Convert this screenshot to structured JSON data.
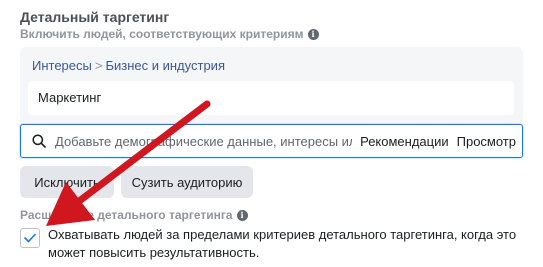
{
  "section": {
    "title": "Детальный таргетинг",
    "subtitle": "Включить людей, соответствующих критериям"
  },
  "selected": {
    "breadcrumb_parent": "Интересы",
    "breadcrumb_separator": ">",
    "breadcrumb_child": "Бизнес и индустрия",
    "item": "Маркетинг"
  },
  "search": {
    "placeholder": "Добавьте демографические данные, интересы или",
    "recommendations_label": "Рекомендации",
    "browse_label": "Просмотр"
  },
  "buttons": {
    "exclude": "Исключить",
    "narrow": "Сузить аудиторию"
  },
  "expansion": {
    "title": "Расширение детального таргетинга",
    "checkbox_checked": true,
    "text": "Охватывать людей за пределами критериев детального таргетинга, когда это может повысить результативность."
  },
  "icons": {
    "info": "info-icon",
    "search": "search-icon",
    "check": "check-icon",
    "annotation": "red-arrow-icon"
  },
  "colors": {
    "link": "#385898",
    "focus_border": "#1877f2",
    "button_bg": "#e4e6eb",
    "arrow": "#d0161f",
    "check": "#1877f2"
  }
}
